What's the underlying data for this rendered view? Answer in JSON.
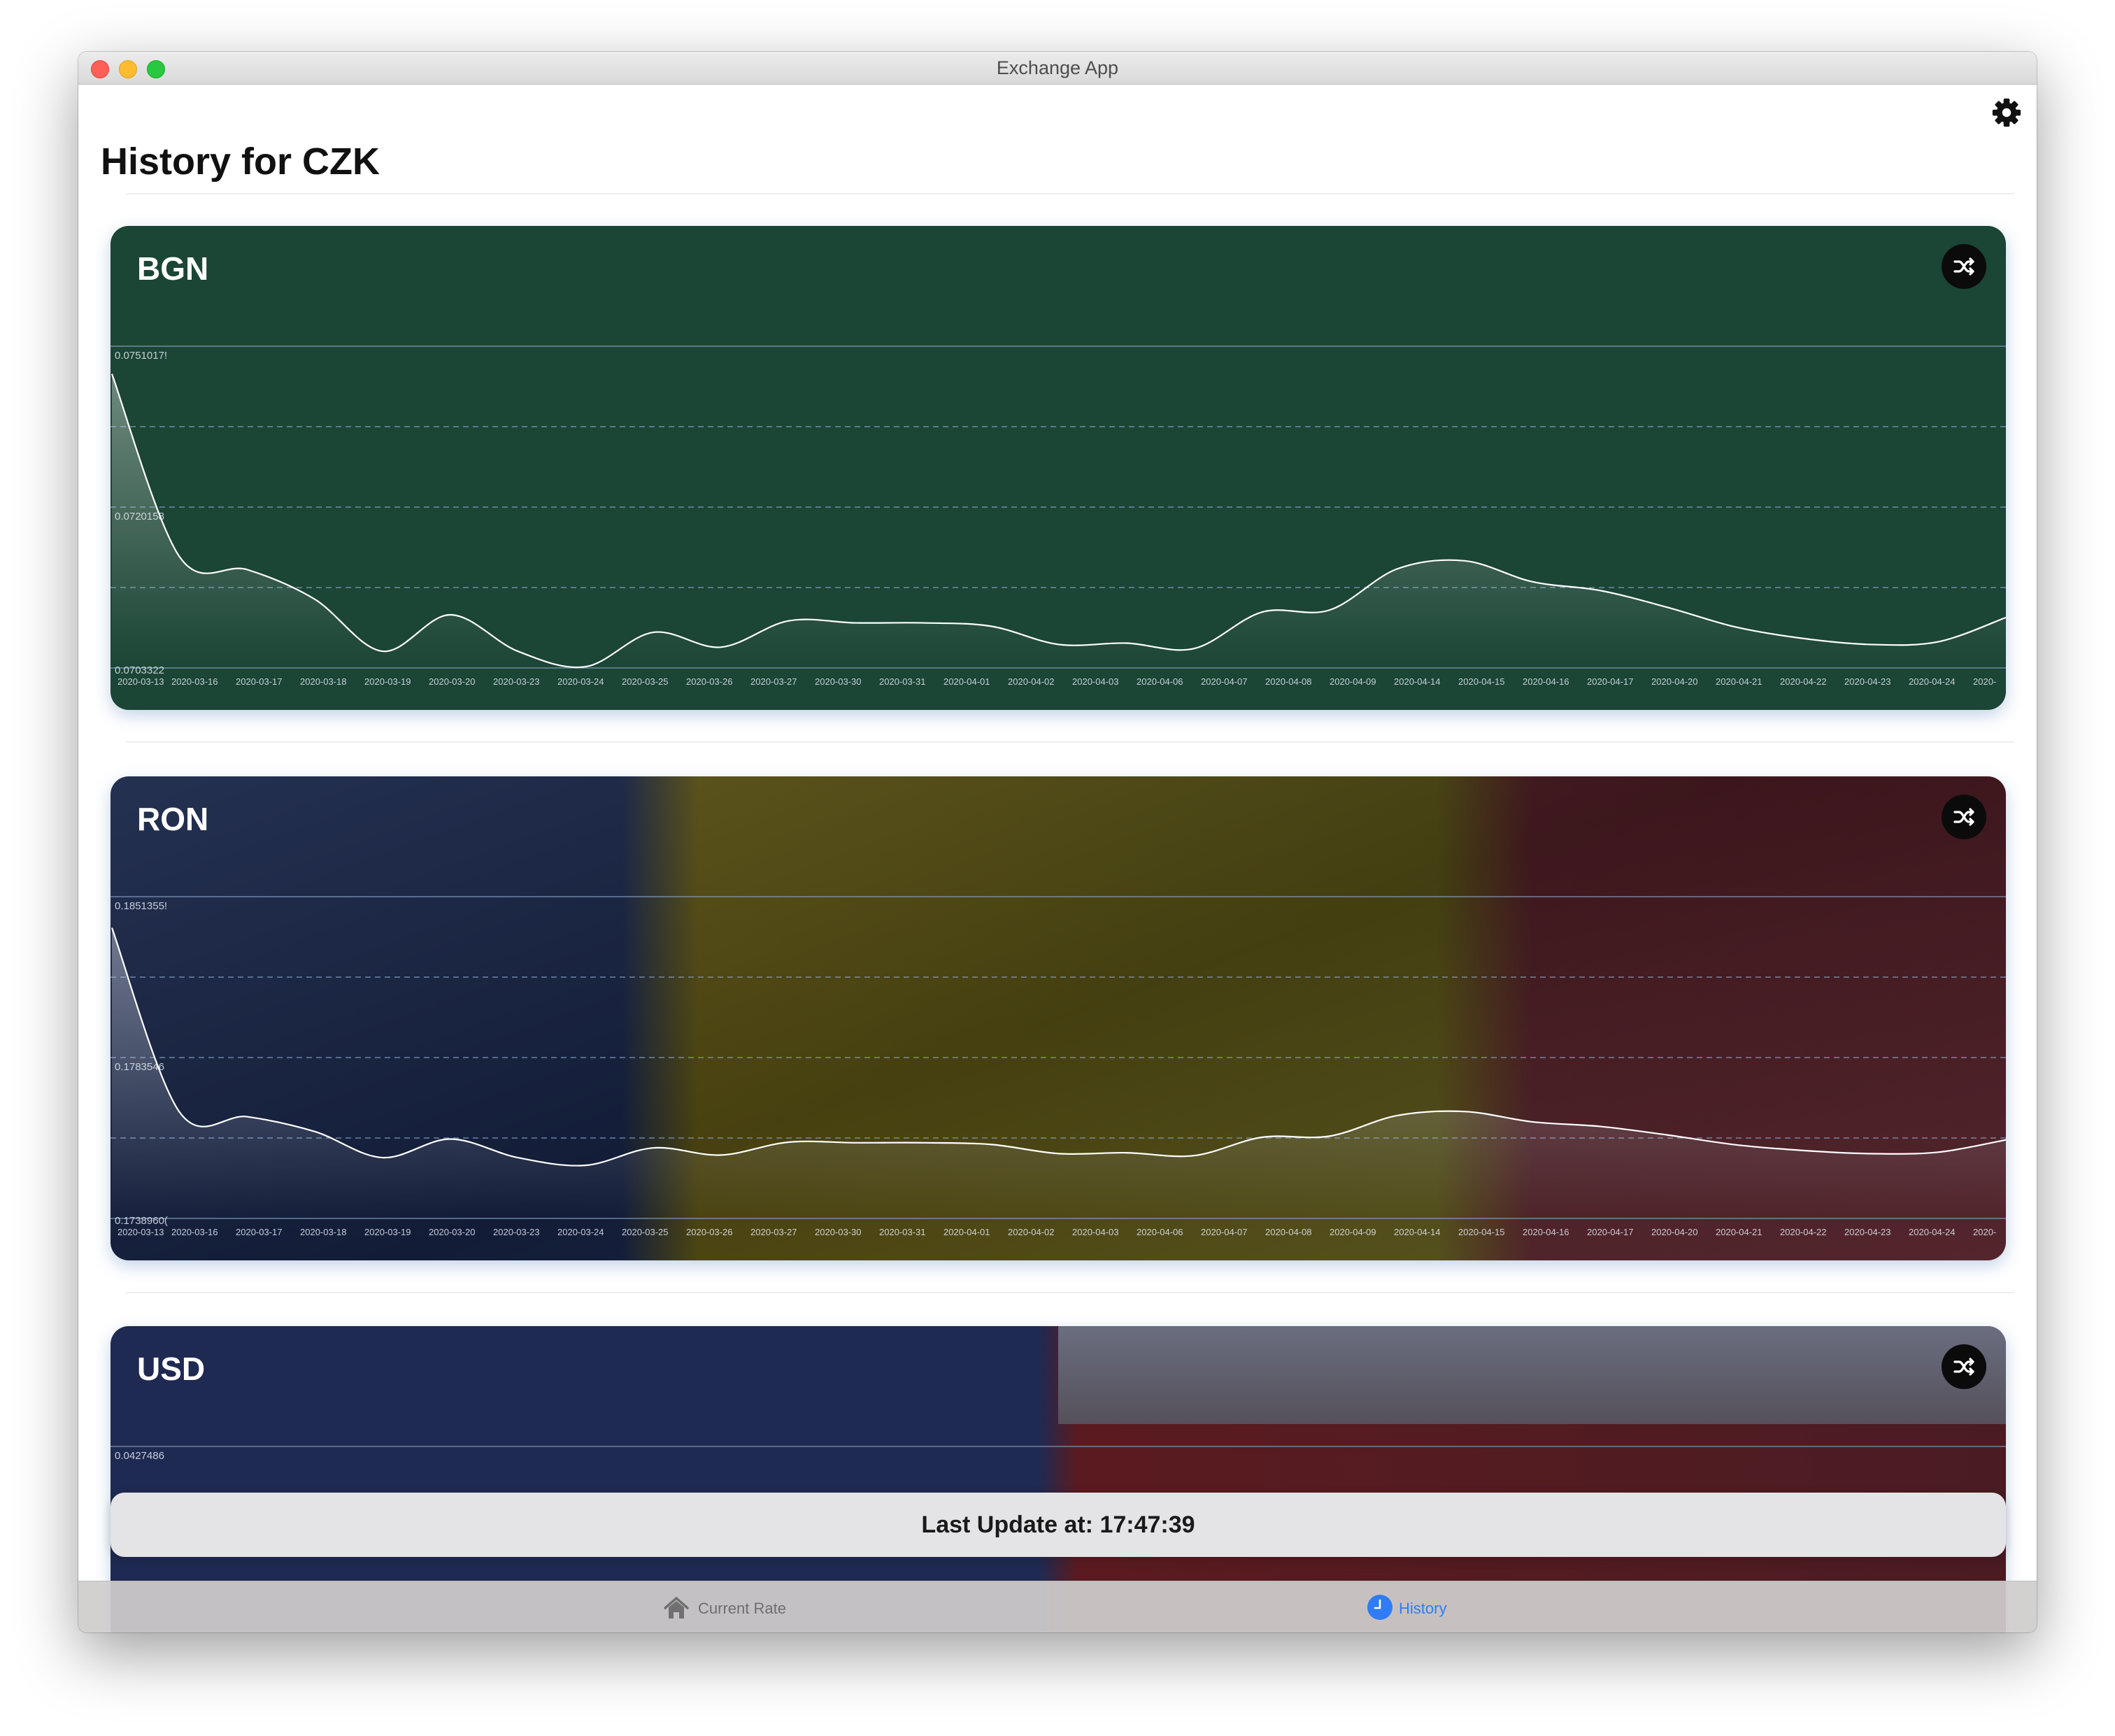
{
  "window": {
    "title": "Exchange App"
  },
  "toolbar": {
    "settings_icon": "gear-icon"
  },
  "page": {
    "title": "History for CZK"
  },
  "dates": [
    "2020-03-13",
    "2020-03-16",
    "2020-03-17",
    "2020-03-18",
    "2020-03-19",
    "2020-03-20",
    "2020-03-23",
    "2020-03-24",
    "2020-03-25",
    "2020-03-26",
    "2020-03-27",
    "2020-03-30",
    "2020-03-31",
    "2020-04-01",
    "2020-04-02",
    "2020-04-03",
    "2020-04-06",
    "2020-04-07",
    "2020-04-08",
    "2020-04-09",
    "2020-04-14",
    "2020-04-15",
    "2020-04-16",
    "2020-04-17",
    "2020-04-20",
    "2020-04-21",
    "2020-04-22",
    "2020-04-23",
    "2020-04-24",
    "2020-"
  ],
  "cards": [
    {
      "code": "BGN",
      "shuffle_icon": "shuffle-icon",
      "y_labels": [
        "0.0751017!",
        "0.0720158",
        "0.0703322"
      ],
      "chart_data": {
        "type": "area",
        "title": "BGN",
        "x": [
          "2020-03-13",
          "2020-03-16",
          "2020-03-17",
          "2020-03-18",
          "2020-03-19",
          "2020-03-20",
          "2020-03-23",
          "2020-03-24",
          "2020-03-25",
          "2020-03-26",
          "2020-03-27",
          "2020-03-30",
          "2020-03-31",
          "2020-04-01",
          "2020-04-02",
          "2020-04-03",
          "2020-04-06",
          "2020-04-07",
          "2020-04-08",
          "2020-04-09",
          "2020-04-14",
          "2020-04-15",
          "2020-04-16",
          "2020-04-17",
          "2020-04-20",
          "2020-04-21",
          "2020-04-22",
          "2020-04-23",
          "2020-04-24"
        ],
        "values": [
          0.07469,
          0.07198,
          0.07179,
          0.07135,
          0.07058,
          0.07112,
          0.07058,
          0.07035,
          0.07086,
          0.07064,
          0.07103,
          0.071,
          0.071,
          0.07095,
          0.07068,
          0.0707,
          0.07062,
          0.07116,
          0.07119,
          0.0718,
          0.07192,
          0.07161,
          0.07148,
          0.07123,
          0.07094,
          0.07077,
          0.07068,
          0.07072,
          0.07108
        ],
        "ylim": [
          0.070332,
          0.075101
        ],
        "grid": true
      }
    },
    {
      "code": "RON",
      "shuffle_icon": "shuffle-icon",
      "y_labels": [
        "0.1851355!",
        "0.1783546",
        "0.1738960("
      ],
      "chart_data": {
        "type": "area",
        "title": "RON",
        "x": [
          "2020-03-13",
          "2020-03-16",
          "2020-03-17",
          "2020-03-18",
          "2020-03-19",
          "2020-03-20",
          "2020-03-23",
          "2020-03-24",
          "2020-03-25",
          "2020-03-26",
          "2020-03-27",
          "2020-03-30",
          "2020-03-31",
          "2020-04-01",
          "2020-04-02",
          "2020-04-03",
          "2020-04-06",
          "2020-04-07",
          "2020-04-08",
          "2020-04-09",
          "2020-04-14",
          "2020-04-15",
          "2020-04-16",
          "2020-04-17",
          "2020-04-20",
          "2020-04-21",
          "2020-04-22",
          "2020-04-23",
          "2020-04-24"
        ],
        "values": [
          0.18405,
          0.17761,
          0.17745,
          0.17693,
          0.17602,
          0.17667,
          0.17602,
          0.17575,
          0.17636,
          0.17611,
          0.17656,
          0.17654,
          0.17654,
          0.17648,
          0.17616,
          0.17619,
          0.17609,
          0.17673,
          0.17677,
          0.17749,
          0.17763,
          0.17727,
          0.17711,
          0.17681,
          0.17647,
          0.17627,
          0.17616,
          0.17621,
          0.17664
        ],
        "ylim": [
          0.173896,
          0.185136
        ],
        "grid": true
      }
    },
    {
      "code": "USD",
      "shuffle_icon": "shuffle-icon",
      "y_labels": [
        "0.0427486"
      ]
    }
  ],
  "toast": {
    "text": "Last Update at: 17:47:39"
  },
  "tabs": [
    {
      "label": "Current Rate",
      "icon": "house-icon",
      "selected": false
    },
    {
      "label": "History",
      "icon": "clock-icon",
      "selected": true,
      "accent": "#2f7cf6"
    }
  ]
}
